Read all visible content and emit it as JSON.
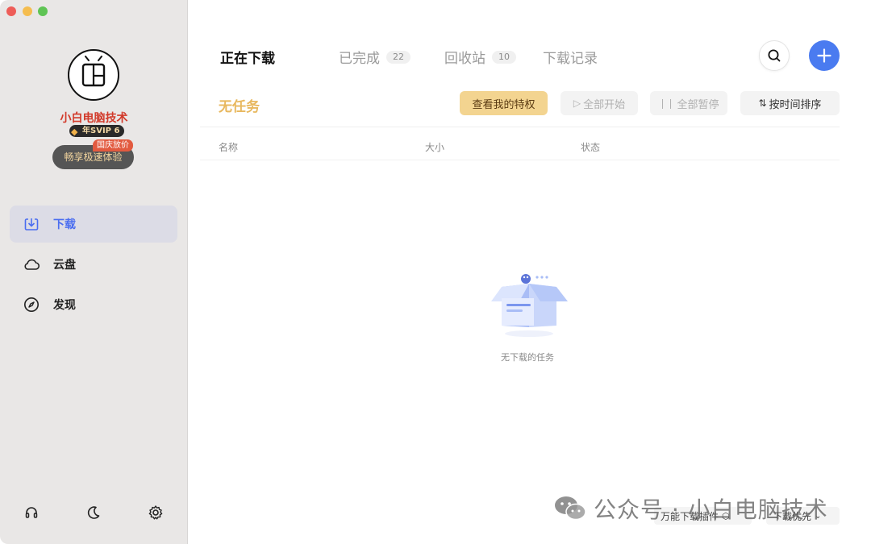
{
  "sidebar": {
    "username": "小白电脑技术",
    "vip_badge": "年SVIP 6",
    "promo_label": "畅享极速体验",
    "promo_badge": "国庆放价",
    "nav": [
      {
        "label": "下载",
        "icon": "download-icon"
      },
      {
        "label": "云盘",
        "icon": "cloud-icon"
      },
      {
        "label": "发现",
        "icon": "compass-icon"
      }
    ],
    "footer_icons": [
      "headset-icon",
      "moon-icon",
      "gear-icon"
    ]
  },
  "tabs": [
    {
      "label": "正在下载"
    },
    {
      "label": "已完成",
      "count": "22"
    },
    {
      "label": "回收站",
      "count": "10"
    },
    {
      "label": "下载记录"
    }
  ],
  "toolbar": {
    "no_task": "无任务",
    "privilege": "查看我的特权",
    "start_all": "全部开始",
    "pause_all": "全部暂停",
    "sort": "按时间排序"
  },
  "columns": {
    "name": "名称",
    "size": "大小",
    "status": "状态"
  },
  "empty": {
    "text": "无下载的任务"
  },
  "bottom": {
    "plugin": "万能下载插件",
    "priority": "下载优先"
  },
  "watermark": "公众号 · 小白电脑技术",
  "colors": {
    "accent": "#4a7bf0",
    "no_task": "#e8b85f",
    "username": "#d23a2a",
    "privilege_bg": "#f3d490"
  }
}
